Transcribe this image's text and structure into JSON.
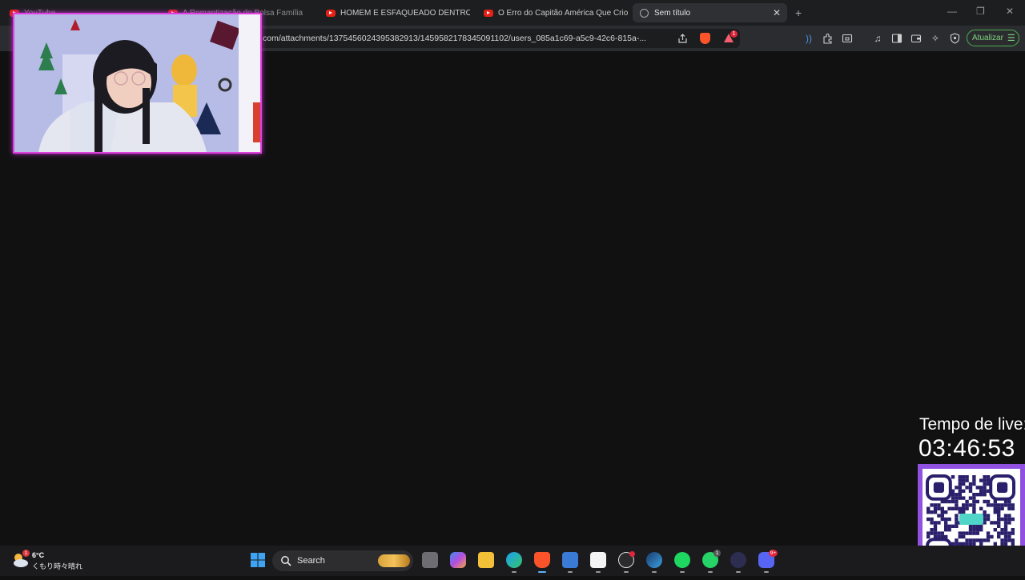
{
  "browser": {
    "tabs": [
      {
        "title": "YouTube",
        "active": false
      },
      {
        "title": "A Romantização do Bolsa Família",
        "active": false
      },
      {
        "title": "HOMEM É ESFAQUEADO DENTRO D",
        "active": false
      },
      {
        "title": "O Erro do Capitão América Que Crio",
        "active": false
      },
      {
        "title": "Sem título",
        "active": true
      }
    ],
    "url": "com/attachments/1375456024395382913/1459582178345091102/users_085a1c69-a5c9-42c6-815a-...",
    "rewards_badge": "1",
    "update_label": "Atualizar",
    "accent_color": "#4caf50"
  },
  "overlay": {
    "live_label": "Tempo de live:",
    "live_time": "03:46:53",
    "frame_color": "#9050e0",
    "webcam_border_color": "#e040e0"
  },
  "taskbar": {
    "weather_temp": "6°C",
    "weather_desc": "くもり時々晴れ",
    "weather_badge": "1",
    "search_label": "Search",
    "apps": [
      {
        "name": "task-view-icon"
      },
      {
        "name": "copilot-icon"
      },
      {
        "name": "file-explorer-icon"
      },
      {
        "name": "edge-icon"
      },
      {
        "name": "brave-icon"
      },
      {
        "name": "microsoft-store-icon"
      },
      {
        "name": "capcut-icon"
      },
      {
        "name": "chatgpt-icon"
      },
      {
        "name": "steam-icon"
      },
      {
        "name": "spotify-icon"
      },
      {
        "name": "whatsapp-icon",
        "badge": "1"
      },
      {
        "name": "obs-icon"
      },
      {
        "name": "discord-icon",
        "badge": "9+"
      }
    ]
  }
}
